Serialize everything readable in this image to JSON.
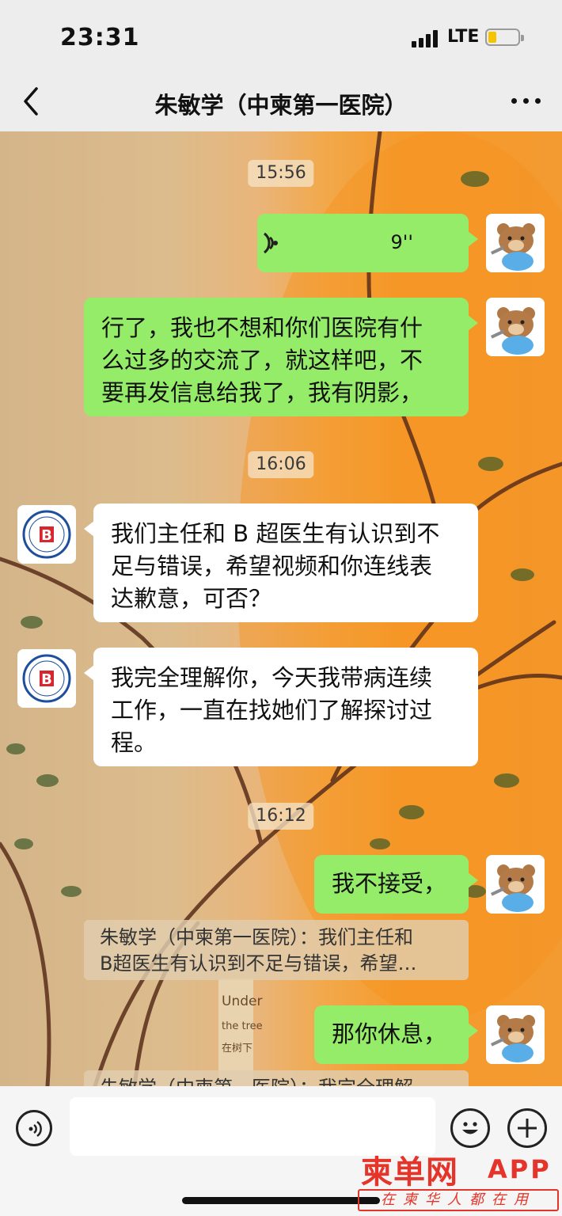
{
  "status_bar": {
    "time": "23:31",
    "network": "LTE",
    "battery_color": "#f5c400"
  },
  "nav": {
    "back_icon": "chevron-left-icon",
    "title": "朱敏学（中柬第一医院）",
    "more_icon": "ellipsis-icon"
  },
  "messages": [
    {
      "type": "timestamp",
      "text": "15:56"
    },
    {
      "type": "voice",
      "from": "me",
      "duration": "9''"
    },
    {
      "type": "text",
      "from": "me",
      "lines": [
        "行了，我也不想和你们医院有什",
        "么过多的交流了，就这样吧，不",
        "要再发信息给我了，我有阴影，"
      ]
    },
    {
      "type": "timestamp",
      "text": "16:06"
    },
    {
      "type": "text",
      "from": "them",
      "lines": [
        "我们主任和 B 超医生有认识到不",
        "足与错误，希望视频和你连线表",
        "达歉意，可否？"
      ]
    },
    {
      "type": "text",
      "from": "them",
      "lines": [
        "我完全理解你，今天我带病连续",
        "工作，一直在找她们了解探讨过",
        "程。"
      ]
    },
    {
      "type": "timestamp",
      "text": "16:12"
    },
    {
      "type": "text",
      "from": "me",
      "lines": [
        "我不接受，"
      ]
    },
    {
      "type": "quote",
      "lines": [
        "朱敏学（中柬第一医院）：我们主任和",
        "B超医生有认识到不足与错误，希望…"
      ]
    },
    {
      "type": "text",
      "from": "me",
      "lines": [
        "那你休息，"
      ]
    },
    {
      "type": "quote",
      "lines": [
        "朱敏学（中柬第一医院）：我完全理解"
      ]
    }
  ],
  "hospital_avatar_letter": "B",
  "hospital_avatar_text": "中柬第一医院",
  "background_sign": [
    "Under",
    "the tree",
    "在树下"
  ],
  "input": {
    "placeholder": "",
    "voice_icon": "voice-icon",
    "emoji_icon": "emoji-icon",
    "plus_icon": "plus-icon"
  },
  "watermark": {
    "main": "柬单网",
    "app": "APP",
    "sub": "在柬华人都在用"
  },
  "colors": {
    "me_bubble": "#95ec69",
    "them_bubble": "#ffffff",
    "watermark": "#e5352a"
  }
}
